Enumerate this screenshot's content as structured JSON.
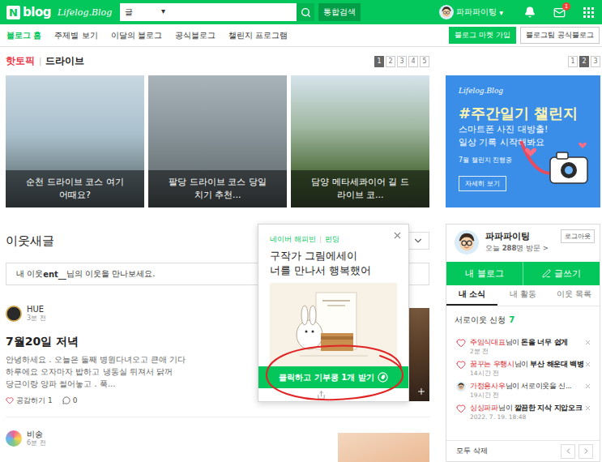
{
  "header": {
    "logo_mark": "N",
    "logo_text": "blog",
    "sublogo": "Lifelog.Blog",
    "search_scope": "글",
    "search_scope_arrow": "▾",
    "search_button": "통합검색",
    "user_name": "파파파이팅",
    "user_arrow": "▾",
    "mail_badge": "1"
  },
  "nav": {
    "items": [
      {
        "label": "블로그 홈",
        "selected": true
      },
      {
        "label": "주제별 보기",
        "selected": false
      },
      {
        "label": "이달의 블로그",
        "selected": false
      },
      {
        "label": "공식블로그",
        "selected": false
      },
      {
        "label": "챌린지 프로그램",
        "selected": false
      }
    ],
    "buttons": [
      {
        "label": "블로그 마켓 가입",
        "kind": "filled"
      },
      {
        "label": "블로그팀 공식블로그",
        "kind": "outline"
      }
    ]
  },
  "hot_topic": {
    "label": "핫토픽",
    "separator": "|",
    "topic": "드라이브",
    "pages": [
      {
        "label": "1",
        "selected": true
      },
      {
        "label": "2",
        "selected": false
      },
      {
        "label": "3",
        "selected": false
      },
      {
        "label": "4",
        "selected": false
      },
      {
        "label": "5",
        "selected": false
      }
    ],
    "cards": [
      {
        "lines": [
          "순천 드라이브 코스 여기",
          "어때요?"
        ]
      },
      {
        "lines": [
          "팔당 드라이브 코스 당일",
          "치기 추천..."
        ]
      },
      {
        "lines": [
          "담양 메타세콰이어 길 드",
          "라이브 코..."
        ]
      }
    ]
  },
  "banner": {
    "pages": [
      {
        "label": "1",
        "selected": false
      },
      {
        "label": "2",
        "selected": true
      },
      {
        "label": "3",
        "selected": false
      }
    ],
    "brand": "Lifelog.Blog",
    "title": "#주간일기 챌린지",
    "lines": [
      "스마트폰 사진 대방출!",
      "일상 기록 시작해봐요"
    ],
    "badge": "7월 챌린지 진행중",
    "button": "자세히 보기"
  },
  "feed": {
    "title": "이웃새글",
    "notice": {
      "prefix": "내 이웃 ",
      "name": "ent__",
      "suffix": "님의 이웃을 만나보세요."
    },
    "posts": [
      {
        "author": "HUE",
        "time": "3분 전",
        "title": "7월20일 저녁",
        "lines": [
          "안녕하세요 . 오늘은 둘째 병원다녀오고 큰애 기다",
          "하루에요 오자마자 밥하고 냉동실 뒤져서 닭꺼",
          "당근이랑 양파 썰어놓고 . 푹..."
        ],
        "like_label": "공감하기",
        "likes": "1",
        "comments": "0"
      },
      {
        "author": "비송",
        "time": "6분 전"
      }
    ]
  },
  "popup": {
    "source": "네이버 해피빈",
    "separator": "|",
    "category": "펀딩",
    "title_lines": [
      "구작가 그림에세이",
      "너를 만나서 행복했어"
    ],
    "button": "클릭하고 기부콩 1개 받기"
  },
  "profile": {
    "name": "파파파이팅",
    "visits_label": "오늘 ",
    "visits": "288",
    "visits_suffix": "명 방문 >",
    "logout": "로그아웃",
    "my_blog": "내 블로그",
    "write": "글쓰기",
    "tabs": [
      {
        "label": "내 소식",
        "selected": true
      },
      {
        "label": "내 활동",
        "selected": false
      },
      {
        "label": "이웃 목록",
        "selected": false
      }
    ],
    "request": {
      "label": "서로이웃 신청",
      "count": "7"
    },
    "news": [
      {
        "kind": "heart",
        "name": "주임식대표",
        "middle": "님이 ",
        "subject": "돈을 너무 쉽게",
        "time": "2분 전"
      },
      {
        "kind": "heart",
        "name": "꿈꾸는 우행시",
        "middle": "님이 ",
        "subject": "부산 해운대 백병",
        "time": "14시간 전"
      },
      {
        "kind": "avatar",
        "name": "가정용사우",
        "middle": "님이 서로이웃을 신...",
        "subject": "",
        "time": "19시간 전"
      },
      {
        "kind": "heart",
        "name": "싱싱파파",
        "middle": "님이 ",
        "subject": "깔끔한 지삭 지압오크",
        "time": "2022. 7. 19. 18:48"
      }
    ],
    "delete_all": "모두 삭제"
  }
}
